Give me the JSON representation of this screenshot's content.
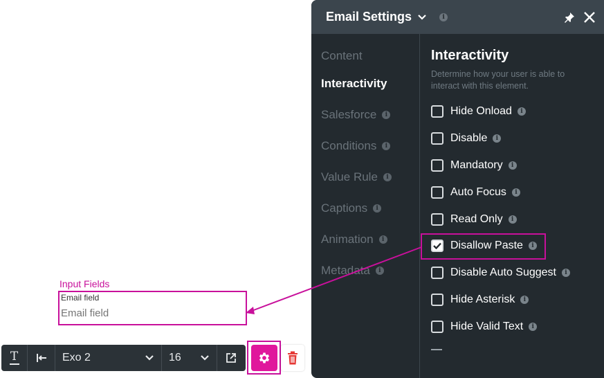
{
  "canvas": {
    "section_label": "Input Fields",
    "field": {
      "label": "Email field",
      "placeholder": "Email field"
    }
  },
  "toolbar": {
    "text_icon": "T",
    "font": "Exo 2",
    "size": "16",
    "highlight_color": "#c8109b",
    "gear_color": "#e0179c",
    "trash_color": "#e53935"
  },
  "panel": {
    "title": "Email Settings",
    "nav": [
      {
        "label": "Content",
        "info": false,
        "active": false
      },
      {
        "label": "Interactivity",
        "info": false,
        "active": true
      },
      {
        "label": "Salesforce",
        "info": true,
        "active": false
      },
      {
        "label": "Conditions",
        "info": true,
        "active": false
      },
      {
        "label": "Value Rule",
        "info": true,
        "active": false
      },
      {
        "label": "Captions",
        "info": true,
        "active": false
      },
      {
        "label": "Animation",
        "info": true,
        "active": false
      },
      {
        "label": "Metadata",
        "info": true,
        "active": false
      }
    ],
    "section": {
      "title": "Interactivity",
      "description": "Determine how your user is able to interact with this element."
    },
    "options": [
      {
        "label": "Hide Onload",
        "checked": false
      },
      {
        "label": "Disable",
        "checked": false
      },
      {
        "label": "Mandatory",
        "checked": false
      },
      {
        "label": "Auto Focus",
        "checked": false
      },
      {
        "label": "Read Only",
        "checked": false
      },
      {
        "label": "Disallow Paste",
        "checked": true
      },
      {
        "label": "Disable Auto Suggest",
        "checked": false
      },
      {
        "label": "Hide Asterisk",
        "checked": false
      },
      {
        "label": "Hide Valid Text",
        "checked": false
      }
    ],
    "info_glyph": "i"
  }
}
